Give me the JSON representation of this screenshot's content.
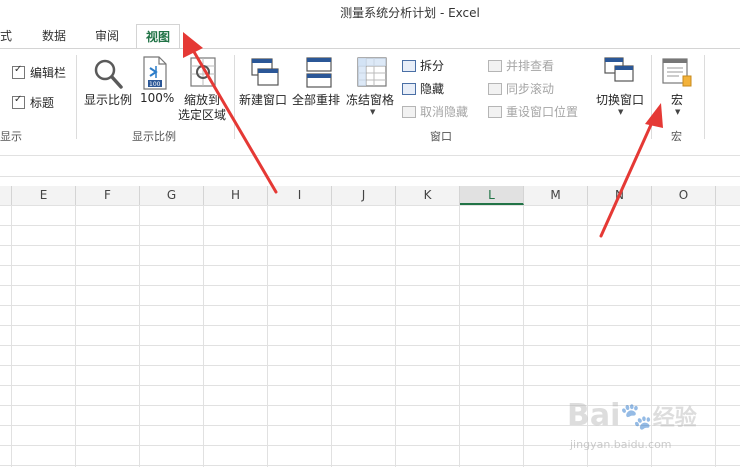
{
  "window": {
    "title": "测量系统分析计划 - Excel"
  },
  "tabs": [
    {
      "label": "式"
    },
    {
      "label": "数据"
    },
    {
      "label": "审阅"
    },
    {
      "label": "视图"
    }
  ],
  "ribbon": {
    "show_group": {
      "checkboxes": [
        {
          "label": "编辑栏",
          "checked": true
        },
        {
          "label": "标题",
          "checked": true
        }
      ],
      "label": "显示"
    },
    "zoom_group": {
      "zoom": "显示比例",
      "zoom100": "100%",
      "zoom_sel_line1": "缩放到",
      "zoom_sel_line2": "选定区域",
      "label": "显示比例"
    },
    "window_group": {
      "new_window": "新建窗口",
      "arrange_all": "全部重排",
      "freeze_panes": "冻结窗格",
      "split": "拆分",
      "hide": "隐藏",
      "unhide": "取消隐藏",
      "side_by_side": "并排查看",
      "sync_scroll": "同步滚动",
      "reset_position": "重设窗口位置",
      "switch_windows": "切换窗口",
      "label": "窗口"
    },
    "macros_group": {
      "macros": "宏",
      "label": "宏"
    }
  },
  "columns": [
    "E",
    "F",
    "G",
    "H",
    "I",
    "J",
    "K",
    "L",
    "M",
    "N",
    "O"
  ],
  "selected_column": "L",
  "watermark": {
    "brand": "Bai",
    "brand2": "经验",
    "url": "jingyan.baidu.com"
  },
  "colors": {
    "accent": "#217346",
    "arrow": "#e53935"
  }
}
